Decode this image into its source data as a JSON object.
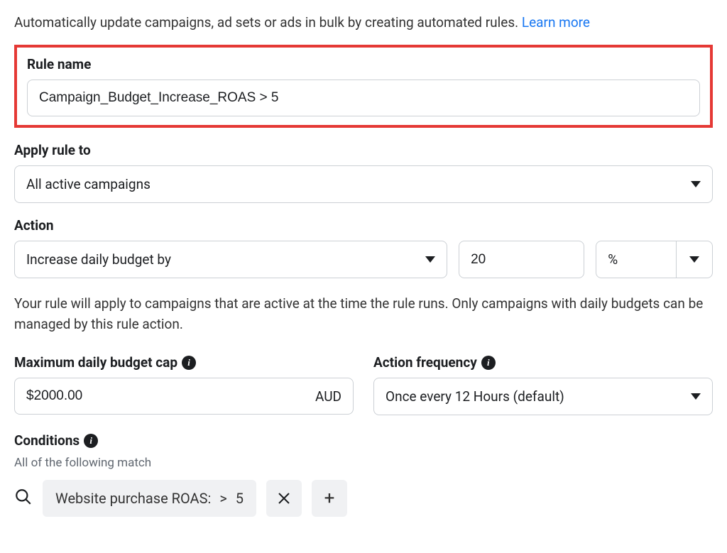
{
  "intro": {
    "text": "Automatically update campaigns, ad sets or ads in bulk by creating automated rules.",
    "learn_more": "Learn more"
  },
  "rule_name": {
    "label": "Rule name",
    "value": "Campaign_Budget_Increase_ROAS > 5"
  },
  "apply_to": {
    "label": "Apply rule to",
    "selected": "All active campaigns"
  },
  "action": {
    "label": "Action",
    "selected": "Increase daily budget by",
    "amount": "20",
    "unit": "%"
  },
  "helper_text": "Your rule will apply to campaigns that are active at the time the rule runs. Only campaigns with daily budgets can be managed by this rule action.",
  "budget_cap": {
    "label": "Maximum daily budget cap",
    "value": "$2000.00",
    "currency": "AUD"
  },
  "frequency": {
    "label": "Action frequency",
    "selected": "Once every 12 Hours (default)"
  },
  "conditions": {
    "label": "Conditions",
    "subtext": "All of the following match",
    "chip_metric": "Website purchase ROAS:",
    "chip_operator": ">",
    "chip_value": "5"
  }
}
